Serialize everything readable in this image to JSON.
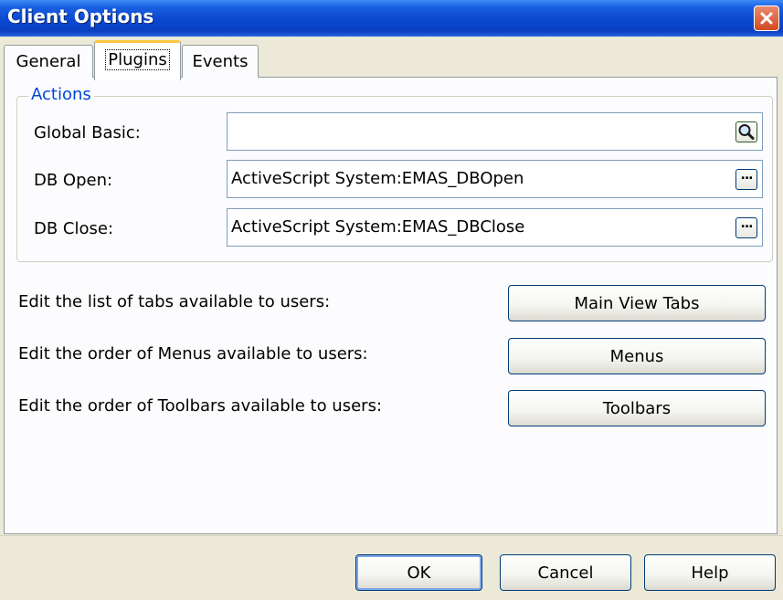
{
  "window": {
    "title": "Client Options"
  },
  "tabs": [
    {
      "label": "General"
    },
    {
      "label": "Plugins"
    },
    {
      "label": "Events"
    }
  ],
  "actions": {
    "group_title": "Actions",
    "global_basic": {
      "label": "Global Basic:",
      "value": ""
    },
    "db_open": {
      "label": "DB Open:",
      "value": "ActiveScript System:EMAS_DBOpen"
    },
    "db_close": {
      "label": "DB Close:",
      "value": "ActiveScript System:EMAS_DBClose"
    }
  },
  "edits": {
    "tabs_text": "Edit the list of tabs available to users:",
    "tabs_button": "Main View Tabs",
    "menus_text": "Edit the order of Menus available to users:",
    "menus_button": "Menus",
    "toolbars_text": "Edit the order of Toolbars available to users:",
    "toolbars_button": "Toolbars"
  },
  "footer": {
    "ok": "OK",
    "cancel": "Cancel",
    "help": "Help"
  },
  "icons": {
    "close": "close-icon",
    "search": "search-icon",
    "ellipsis": "ellipsis-icon"
  }
}
